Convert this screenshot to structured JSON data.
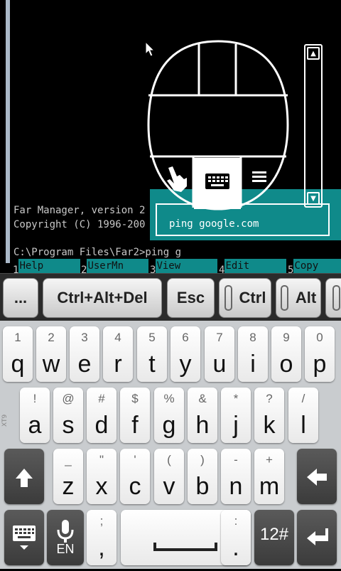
{
  "terminal": {
    "line1": "Far Manager, version 2",
    "line2": "Copyright (C) 1996-200",
    "prompt": "C:\\Program Files\\Far2>ping g",
    "command_input": "ping google.com",
    "function_keys": [
      {
        "num": "1",
        "label": "Help"
      },
      {
        "num": "2",
        "label": "UserMn"
      },
      {
        "num": "3",
        "label": "View"
      },
      {
        "num": "4",
        "label": "Edit"
      },
      {
        "num": "5",
        "label": "Copy"
      }
    ]
  },
  "toolbar": {
    "more": "...",
    "ctrl_alt_del": "Ctrl+Alt+Del",
    "esc": "Esc",
    "ctrl": "Ctrl",
    "alt": "Alt"
  },
  "keyboard": {
    "row1": [
      {
        "alt": "1",
        "main": "q"
      },
      {
        "alt": "2",
        "main": "w"
      },
      {
        "alt": "3",
        "main": "e"
      },
      {
        "alt": "4",
        "main": "r"
      },
      {
        "alt": "5",
        "main": "t"
      },
      {
        "alt": "6",
        "main": "y"
      },
      {
        "alt": "7",
        "main": "u"
      },
      {
        "alt": "8",
        "main": "i"
      },
      {
        "alt": "9",
        "main": "o"
      },
      {
        "alt": "0",
        "main": "p"
      }
    ],
    "row2": [
      {
        "alt": "!",
        "main": "a"
      },
      {
        "alt": "@",
        "main": "s"
      },
      {
        "alt": "#",
        "main": "d"
      },
      {
        "alt": "$",
        "main": "f"
      },
      {
        "alt": "%",
        "main": "g"
      },
      {
        "alt": "&",
        "main": "h"
      },
      {
        "alt": "*",
        "main": "j"
      },
      {
        "alt": "?",
        "main": "k"
      },
      {
        "alt": "/",
        "main": "l"
      }
    ],
    "row3": [
      {
        "alt": "_",
        "main": "z"
      },
      {
        "alt": "\"",
        "main": "x"
      },
      {
        "alt": "'",
        "main": "c"
      },
      {
        "alt": "(",
        "main": "v"
      },
      {
        "alt": ")",
        "main": "b"
      },
      {
        "alt": "-",
        "main": "n"
      },
      {
        "alt": "+",
        "main": "m"
      }
    ],
    "side_label": "XT9",
    "lang": "EN",
    "semicolon_alt": ";",
    "semicolon_main": ",",
    "colon_alt": ":",
    "colon_main": ".",
    "symbols": "12#"
  },
  "colors": {
    "terminal_teal": "#0f8a8a",
    "keyboard_bg": "#c9cccf"
  }
}
